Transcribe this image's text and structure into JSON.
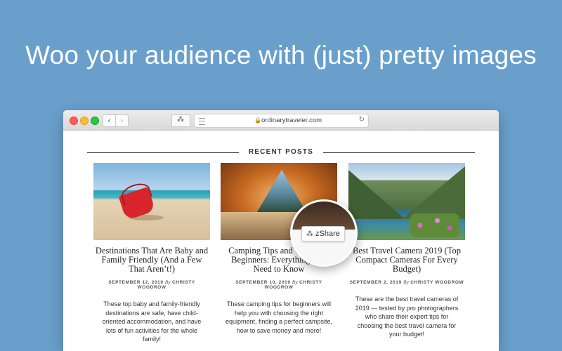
{
  "headline": "Woo your audience with (just) pretty images",
  "browser": {
    "url": "ordinarytraveler.com",
    "back_glyph": "‹",
    "forward_glyph": "›",
    "lock_glyph": "🔒",
    "reload_glyph": "↻",
    "extension_glyph": "⁂"
  },
  "section": {
    "title": "RECENT POSTS"
  },
  "posts": [
    {
      "title": "Destinations That Are Baby and Family Friendly (And a Few That Aren’t!)",
      "date": "SEPTEMBER 12, 2019",
      "by": "By",
      "author": "CHRISTY WOODROW",
      "excerpt": "These top baby and family-friendly destinations are safe, have child-oriented accommodation, and have lots of fun activities for the whole family!",
      "image": "beach-red-bucket"
    },
    {
      "title": "Camping Tips and Tricks for Beginners: Everything You Need to Know",
      "date": "SEPTEMBER 10, 2019",
      "by": "By",
      "author": "CHRISTY WOODROW",
      "excerpt": "These camping tips for beginners will help you with choosing the right equipment, finding a perfect campsite, how to save money and more!",
      "image": "tent-interior"
    },
    {
      "title": "Best Travel Camera 2019 (Top Compact Cameras For Every Budget)",
      "date": "SEPTEMBER 2, 2019",
      "by": "By",
      "author": "CHRISTY WOODROW",
      "excerpt": "These are the best travel cameras of 2019 — tested by pro photographers who share their expert tips for choosing the best travel camera for your budget!",
      "image": "fjord-flowers"
    }
  ],
  "zshare": {
    "label": "zShare",
    "icon_glyph": "⁂"
  },
  "colors": {
    "background": "#6a9fcc",
    "text": "#222222"
  }
}
